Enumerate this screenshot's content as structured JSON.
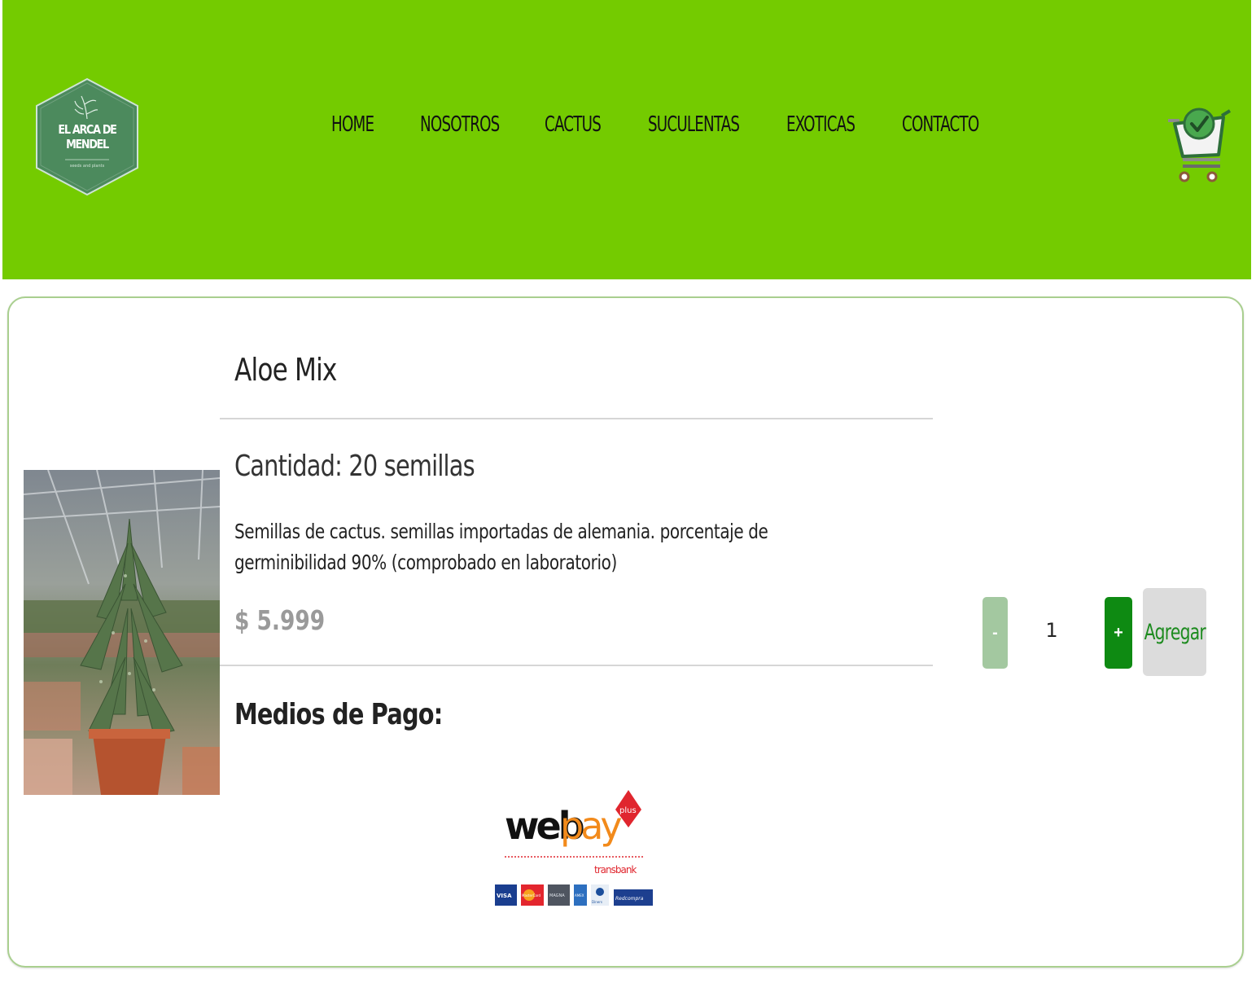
{
  "brand": {
    "logo_text_line1": "EL ARCA DE",
    "logo_text_line2": "MENDEL",
    "logo_subtitle": "seeds and plants",
    "header_color": "#74cb00",
    "logo_color": "#4c8a5d"
  },
  "nav": {
    "items": [
      {
        "label": "HOME"
      },
      {
        "label": "NOSOTROS"
      },
      {
        "label": "CACTUS"
      },
      {
        "label": "SUCULENTAS"
      },
      {
        "label": "EXOTICAS"
      },
      {
        "label": "CONTACTO"
      }
    ]
  },
  "cart": {
    "icon": "shopping-cart-check-icon"
  },
  "product": {
    "title": "Aloe Mix",
    "quantity_label": "Cantidad: 20 semillas",
    "description": "Semillas de cactus. semillas importadas de alemania. porcentaje de germinibilidad 90% (comprobado en laboratorio)",
    "price": "$ 5.999",
    "payment_title": "Medios de Pago:"
  },
  "payment": {
    "webpay_word1": "web",
    "webpay_word2": "pay",
    "webpay_badge": "plus",
    "transbank": "transbank",
    "cards": [
      "VISA",
      "MasterCard",
      "MAGNA",
      "AMEX",
      "Diners",
      "Redcompra"
    ]
  },
  "purchase": {
    "minus_label": "-",
    "quantity": "1",
    "plus_label": "+",
    "add_label": "Agregar"
  }
}
